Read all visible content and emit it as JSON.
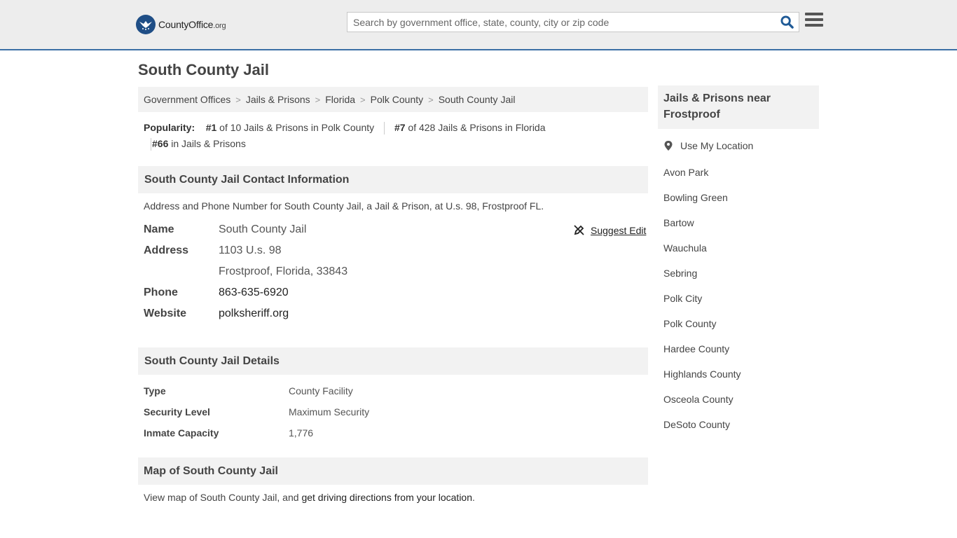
{
  "header": {
    "logo_main": "CountyOffice",
    "logo_tld": ".org",
    "search_placeholder": "Search by government office, state, county, city or zip code"
  },
  "page": {
    "title": "South County Jail"
  },
  "breadcrumb": [
    "Government Offices",
    "Jails & Prisons",
    "Florida",
    "Polk County",
    "South County Jail"
  ],
  "popularity": {
    "label": "Popularity:",
    "items": [
      {
        "rank": "#1",
        "text": "of 10 Jails & Prisons in Polk County"
      },
      {
        "rank": "#7",
        "text": "of 428 Jails & Prisons in Florida"
      },
      {
        "rank": "#66",
        "text": "in Jails & Prisons"
      }
    ]
  },
  "contact": {
    "heading": "South County Jail Contact Information",
    "description": "Address and Phone Number for South County Jail, a Jail & Prison, at U.s. 98, Frostproof FL.",
    "suggest_edit": "Suggest Edit",
    "name_label": "Name",
    "name": "South County Jail",
    "address_label": "Address",
    "address_line1": "1103 U.s. 98",
    "address_line2": "Frostproof, Florida, 33843",
    "phone_label": "Phone",
    "phone": "863-635-6920",
    "website_label": "Website",
    "website": "polksheriff.org"
  },
  "details": {
    "heading": "South County Jail Details",
    "rows": [
      {
        "label": "Type",
        "value": "County Facility"
      },
      {
        "label": "Security Level",
        "value": "Maximum Security"
      },
      {
        "label": "Inmate Capacity",
        "value": "1,776"
      }
    ]
  },
  "map": {
    "heading": "Map of South County Jail",
    "text_prefix": "View map of South County Jail, and ",
    "link": "get driving directions from your location",
    "text_suffix": "."
  },
  "sidebar": {
    "heading": "Jails & Prisons near Frostproof",
    "use_location": "Use My Location",
    "links": [
      "Avon Park",
      "Bowling Green",
      "Bartow",
      "Wauchula",
      "Sebring",
      "Polk City",
      "Polk County",
      "Hardee County",
      "Highlands County",
      "Osceola County",
      "DeSoto County"
    ]
  },
  "colors": {
    "accent": "#3b6fa5",
    "logo": "#1f4e86",
    "search_icon": "#1f5a96",
    "panel_bg": "#f2f2f2",
    "topbar_bg": "#ededed"
  },
  "icons": [
    "logo-eagle-icon",
    "search-icon",
    "hamburger-menu-icon",
    "suggest-edit-icon",
    "location-pin-icon"
  ]
}
